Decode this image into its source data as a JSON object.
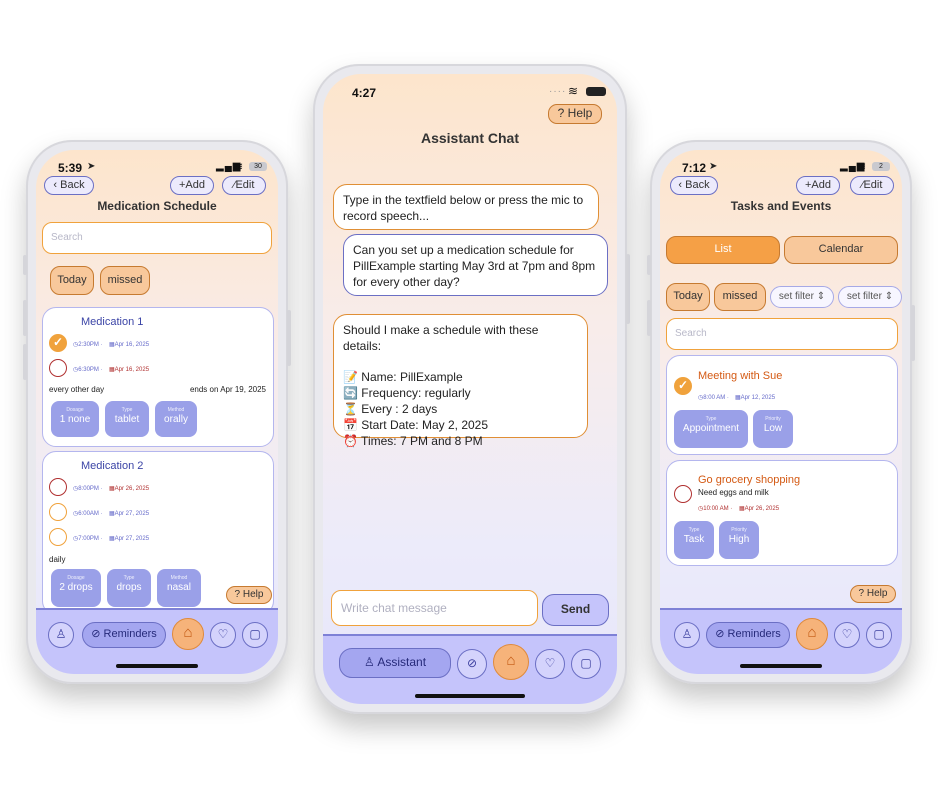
{
  "left": {
    "status": {
      "time": "5:39",
      "battery": "30"
    },
    "back_label": "Back",
    "add_label": "Add",
    "edit_label": "Edit",
    "title": "Medication Schedule",
    "search_placeholder": "Search",
    "chips": [
      "Today",
      "missed"
    ],
    "medications": [
      {
        "name": "Medication 1",
        "doses": [
          {
            "time": "2:30PM",
            "date": "Apr 16, 2025",
            "status": "done"
          },
          {
            "time": "6:30PM",
            "date": "Apr 16, 2025",
            "status": "missed"
          }
        ],
        "frequency": "every other day",
        "ends": "ends on Apr 19, 2025",
        "tiles": [
          {
            "label": "Dosage",
            "value": "1 none"
          },
          {
            "label": "Type",
            "value": "tablet"
          },
          {
            "label": "Method",
            "value": "orally"
          }
        ]
      },
      {
        "name": "Medication 2",
        "doses": [
          {
            "time": "8:00PM",
            "date": "Apr 26, 2025",
            "status": "missed"
          },
          {
            "time": "6:00AM",
            "date": "Apr 27, 2025",
            "status": "upcoming"
          },
          {
            "time": "7:00PM",
            "date": "Apr 27, 2025",
            "status": "upcoming"
          }
        ],
        "frequency": "daily",
        "tiles": [
          {
            "label": "Dosage",
            "value": "2 drops"
          },
          {
            "label": "Type",
            "value": "drops"
          },
          {
            "label": "Method",
            "value": "nasal"
          }
        ]
      }
    ],
    "help_label": "Help",
    "nav": {
      "reminders_label": "Reminders"
    }
  },
  "center": {
    "status": {
      "time": "4:27"
    },
    "help_label": "Help",
    "title": "Assistant Chat",
    "messages": [
      {
        "role": "assistant",
        "text": "Type in the textfield below or press the mic to record speech..."
      },
      {
        "role": "user",
        "text": "Can you set up a medication schedule for PillExample starting May 3rd at 7pm and 8pm for every other day?"
      },
      {
        "role": "assistant",
        "intro": "Should I make a schedule with these details:",
        "lines": [
          "📝 Name: PillExample",
          "🔄 Frequency: regularly",
          "⏳ Every : 2 days",
          "📅 Start Date: May 2, 2025",
          "⏰ Times: 7 PM and 8 PM"
        ]
      }
    ],
    "input_placeholder": "Write chat message",
    "send_label": "Send",
    "nav": {
      "assistant_label": "Assistant"
    }
  },
  "right": {
    "status": {
      "time": "7:12",
      "battery": "2"
    },
    "back_label": "Back",
    "add_label": "Add",
    "edit_label": "Edit",
    "title": "Tasks and Events",
    "tabs": [
      "List",
      "Calendar"
    ],
    "chips": [
      "Today",
      "missed"
    ],
    "filters": [
      "set filter",
      "set filter"
    ],
    "search_placeholder": "Search",
    "items": [
      {
        "title": "Meeting with Sue",
        "time": "8:00 AM",
        "date": "Apr 12, 2025",
        "status": "done",
        "tiles": [
          {
            "label": "Type",
            "value": "Appointment"
          },
          {
            "label": "Priority",
            "value": "Low"
          }
        ]
      },
      {
        "title": "Go grocery shopping",
        "note": "Need eggs and milk",
        "time": "10:00 AM",
        "date": "Apr 26, 2025",
        "status": "missed",
        "tiles": [
          {
            "label": "Type",
            "value": "Task"
          },
          {
            "label": "Priority",
            "value": "High"
          }
        ]
      }
    ],
    "help_label": "Help",
    "nav": {
      "reminders_label": "Reminders"
    }
  },
  "icons": {
    "location": "location-arrow-icon",
    "signal": "signal-icon",
    "wifi": "wifi-icon",
    "battery": "battery-icon",
    "back": "chevron-left-icon",
    "add": "plus-icon",
    "edit": "pencil-icon",
    "help": "question-icon",
    "clock": "clock-icon",
    "calendar": "calendar-icon",
    "person": "person-icon",
    "pill": "pill-icon",
    "home": "home-icon",
    "heart": "heart-icon",
    "chat": "chat-icon",
    "check": "check-icon",
    "updown": "chevron-updown-icon"
  },
  "colors": {
    "accent_orange": "#f0a23c",
    "accent_purple": "#6b6fc4",
    "missed_red": "#b03030",
    "nav_bg": "#c5c4fb"
  }
}
